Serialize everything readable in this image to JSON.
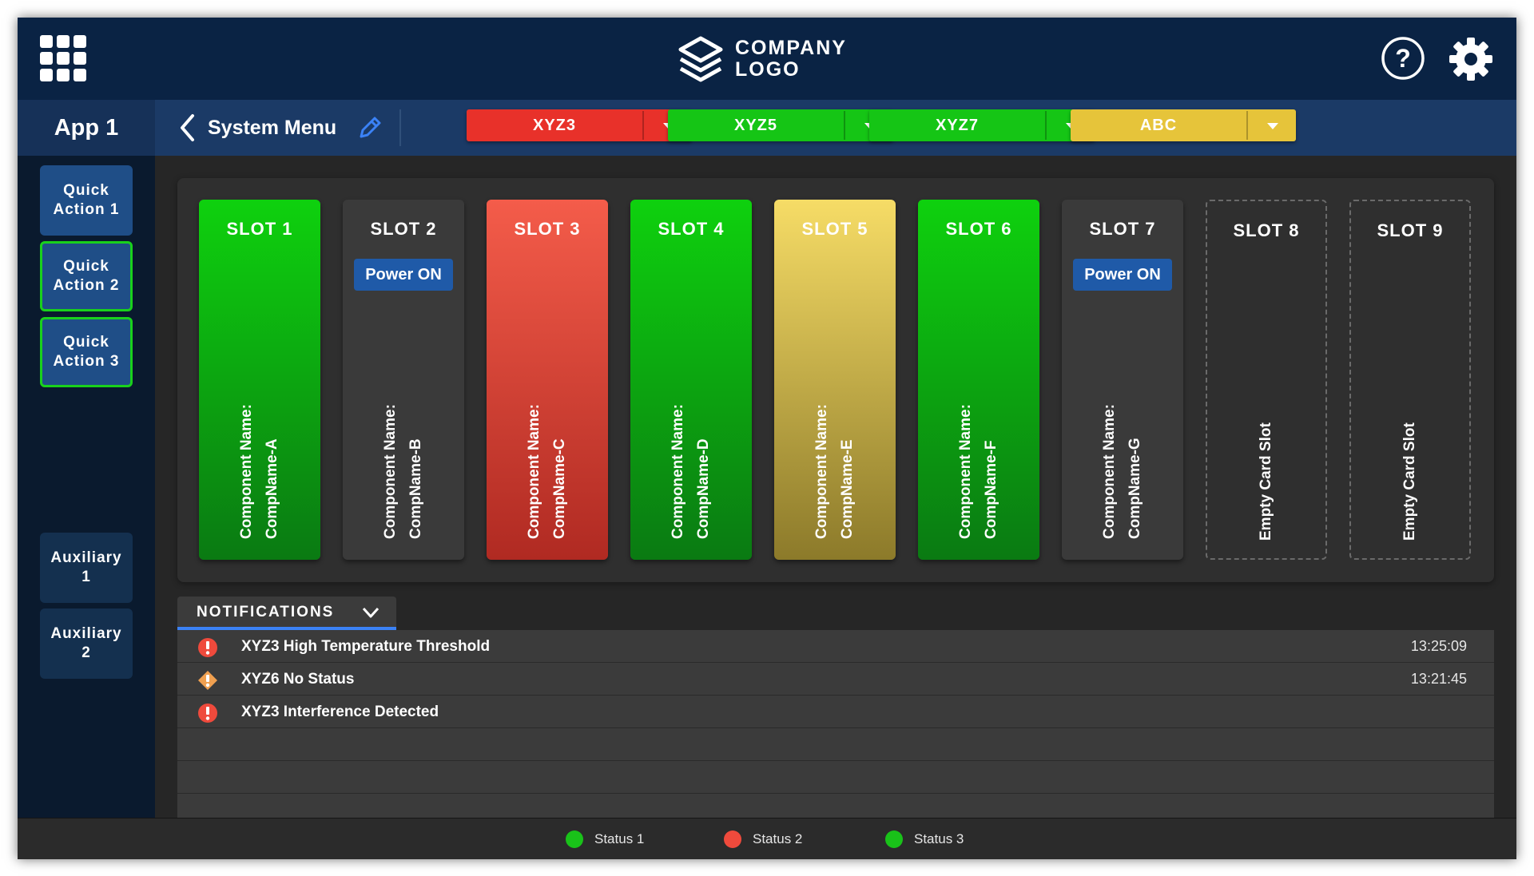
{
  "header": {
    "logo_line1": "COMPANY",
    "logo_line2": "LOGO"
  },
  "nav": {
    "app_name": "App 1",
    "title": "System Menu",
    "dropdowns": [
      {
        "label": "XYZ3",
        "color": "#e8312a"
      },
      {
        "label": "XYZ5",
        "color": "#15c515"
      },
      {
        "label": "XYZ7",
        "color": "#15c515"
      },
      {
        "label": "ABC",
        "color": "#e6c43a"
      }
    ]
  },
  "sidebar": {
    "quick_actions": [
      {
        "label": "Quick\nAction 1"
      },
      {
        "label": "Quick\nAction 2"
      },
      {
        "label": "Quick\nAction 3"
      }
    ],
    "auxiliary": [
      {
        "label": "Auxiliary\n1"
      },
      {
        "label": "Auxiliary\n2"
      }
    ]
  },
  "slots": [
    {
      "title": "SLOT 1",
      "state": "green",
      "component": "Component Name:\nCompName-A"
    },
    {
      "title": "SLOT 2",
      "state": "grey",
      "button": "Power ON",
      "component": "Component Name:\nCompName-B"
    },
    {
      "title": "SLOT 3",
      "state": "red",
      "component": "Component Name:\nCompName-C"
    },
    {
      "title": "SLOT 4",
      "state": "green",
      "component": "Component Name:\nCompName-D"
    },
    {
      "title": "SLOT 5",
      "state": "yellow",
      "component": "Component Name:\nCompName-E"
    },
    {
      "title": "SLOT 6",
      "state": "green",
      "component": "Component Name:\nCompName-F"
    },
    {
      "title": "SLOT 7",
      "state": "grey",
      "button": "Power ON",
      "component": "Component Name:\nCompName-G"
    },
    {
      "title": "SLOT 8",
      "state": "empty",
      "component": "Empty Card Slot"
    },
    {
      "title": "SLOT 9",
      "state": "empty",
      "component": "Empty Card Slot"
    }
  ],
  "notifications": {
    "label": "NOTIFICATIONS",
    "items": [
      {
        "icon": "error-icon",
        "text": "XYZ3 High Temperature Threshold",
        "time": "13:25:09"
      },
      {
        "icon": "warning-icon",
        "text": "XYZ6 No Status",
        "time": "13:21:45"
      },
      {
        "icon": "error-icon",
        "text": "XYZ3 Interference Detected",
        "time": ""
      }
    ]
  },
  "status_bar": [
    {
      "label": "Status 1",
      "color": "#19c219"
    },
    {
      "label": "Status 2",
      "color": "#ef4a3c"
    },
    {
      "label": "Status 3",
      "color": "#19c219"
    }
  ],
  "colors": {
    "accent_blue": "#3b82f6",
    "ok_green": "#15c515",
    "alarm_red": "#e8312a",
    "warn_yellow": "#e6c43a"
  }
}
